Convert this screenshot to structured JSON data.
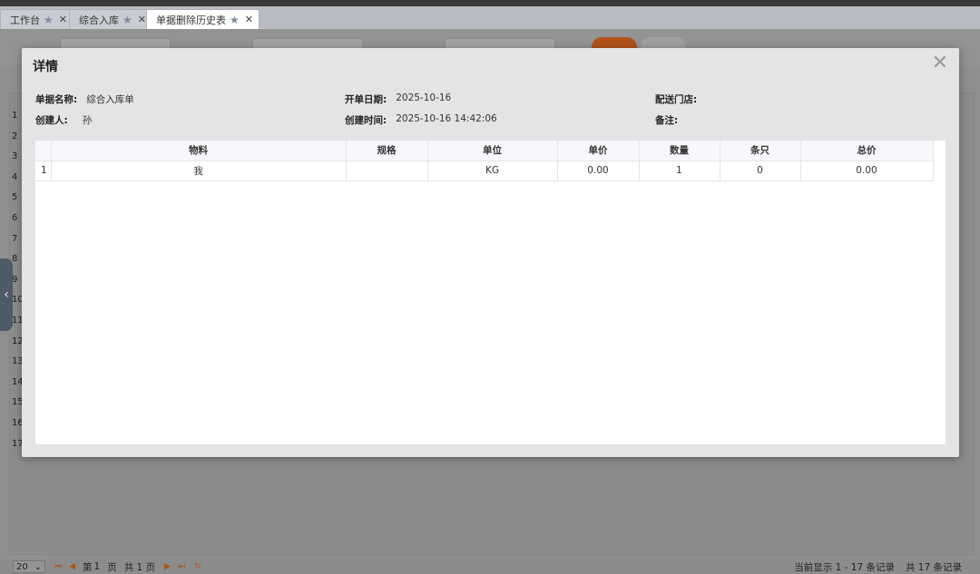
{
  "tabs": [
    {
      "label": "工作台",
      "active": false
    },
    {
      "label": "综合入库",
      "active": false
    },
    {
      "label": "单据删除历史表",
      "active": true
    }
  ],
  "background_rows": [
    "1",
    "2",
    "3",
    "4",
    "5",
    "6",
    "7",
    "8",
    "9",
    "10",
    "11",
    "12",
    "13",
    "14",
    "15",
    "16",
    "17"
  ],
  "modal": {
    "title": "详情",
    "fields": {
      "doc_name_label": "单据名称:",
      "doc_name_value": "综合入库单",
      "creator_label": "创建人:",
      "creator_value": "孙",
      "open_date_label": "开单日期:",
      "open_date_value": "2025-10-16",
      "create_time_label": "创建时间:",
      "create_time_value": "2025-10-16 14:42:06",
      "delivery_store_label": "配送门店:",
      "delivery_store_value": "",
      "remark_label": "备注:",
      "remark_value": ""
    },
    "table": {
      "columns": [
        "",
        "物料",
        "规格",
        "单位",
        "单价",
        "数量",
        "条只",
        "总价"
      ],
      "rows": [
        [
          "1",
          "我",
          "",
          "KG",
          "0.00",
          "1",
          "0",
          "0.00"
        ]
      ]
    }
  },
  "pager": {
    "page_size": "20",
    "page_prefix": "第",
    "current_page": "1",
    "page_suffix": "页",
    "total_pages": "共 1 页",
    "display_info": "当前显示 1 - 17 条记录",
    "total_records": "共 17 条记录"
  }
}
